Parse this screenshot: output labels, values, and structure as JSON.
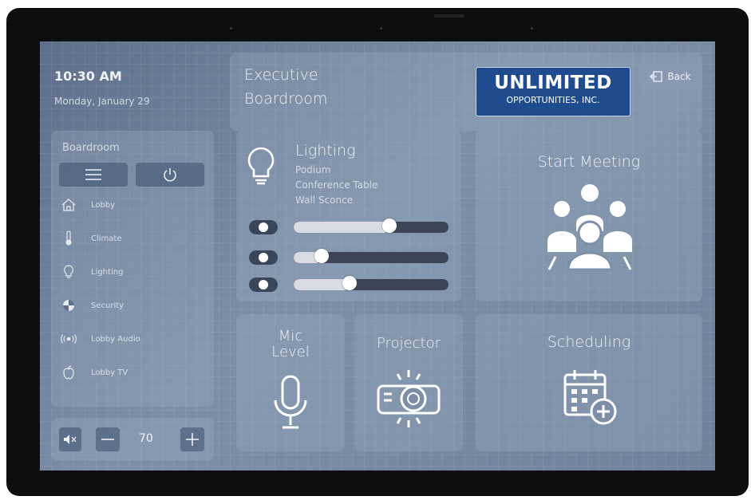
{
  "header": {
    "time": "10:30 AM",
    "date": "Monday, January 29",
    "room_title_line1": "Executive",
    "room_title_line2": "Boardroom",
    "logo_line1": "UNLIMITED",
    "logo_line2": "OPPORTUNITIES, INC.",
    "back_label": "Back"
  },
  "sidebar": {
    "title": "Boardroom",
    "items": [
      {
        "label": "Lobby",
        "icon": "home-icon"
      },
      {
        "label": "Climate",
        "icon": "thermometer-icon"
      },
      {
        "label": "Lighting",
        "icon": "lightbulb-icon"
      },
      {
        "label": "Security",
        "icon": "security-icon"
      },
      {
        "label": "Lobby Audio",
        "icon": "audio-broadcast-icon"
      },
      {
        "label": "Lobby TV",
        "icon": "apple-tv-icon"
      }
    ],
    "volume": "70"
  },
  "lighting": {
    "title": "Lighting",
    "zones": [
      "Podium",
      "Conference Table",
      "Wall Sconce"
    ],
    "levels": [
      0.62,
      0.18,
      0.36
    ]
  },
  "tiles": {
    "start_meeting": "Start Meeting",
    "mic_level_line1": "Mic",
    "mic_level_line2": "Level",
    "projector": "Projector",
    "scheduling": "Scheduling"
  },
  "colors": {
    "accent": "#1f4c8f",
    "panel": "#96a8be",
    "toggle_track": "#3a4658"
  }
}
